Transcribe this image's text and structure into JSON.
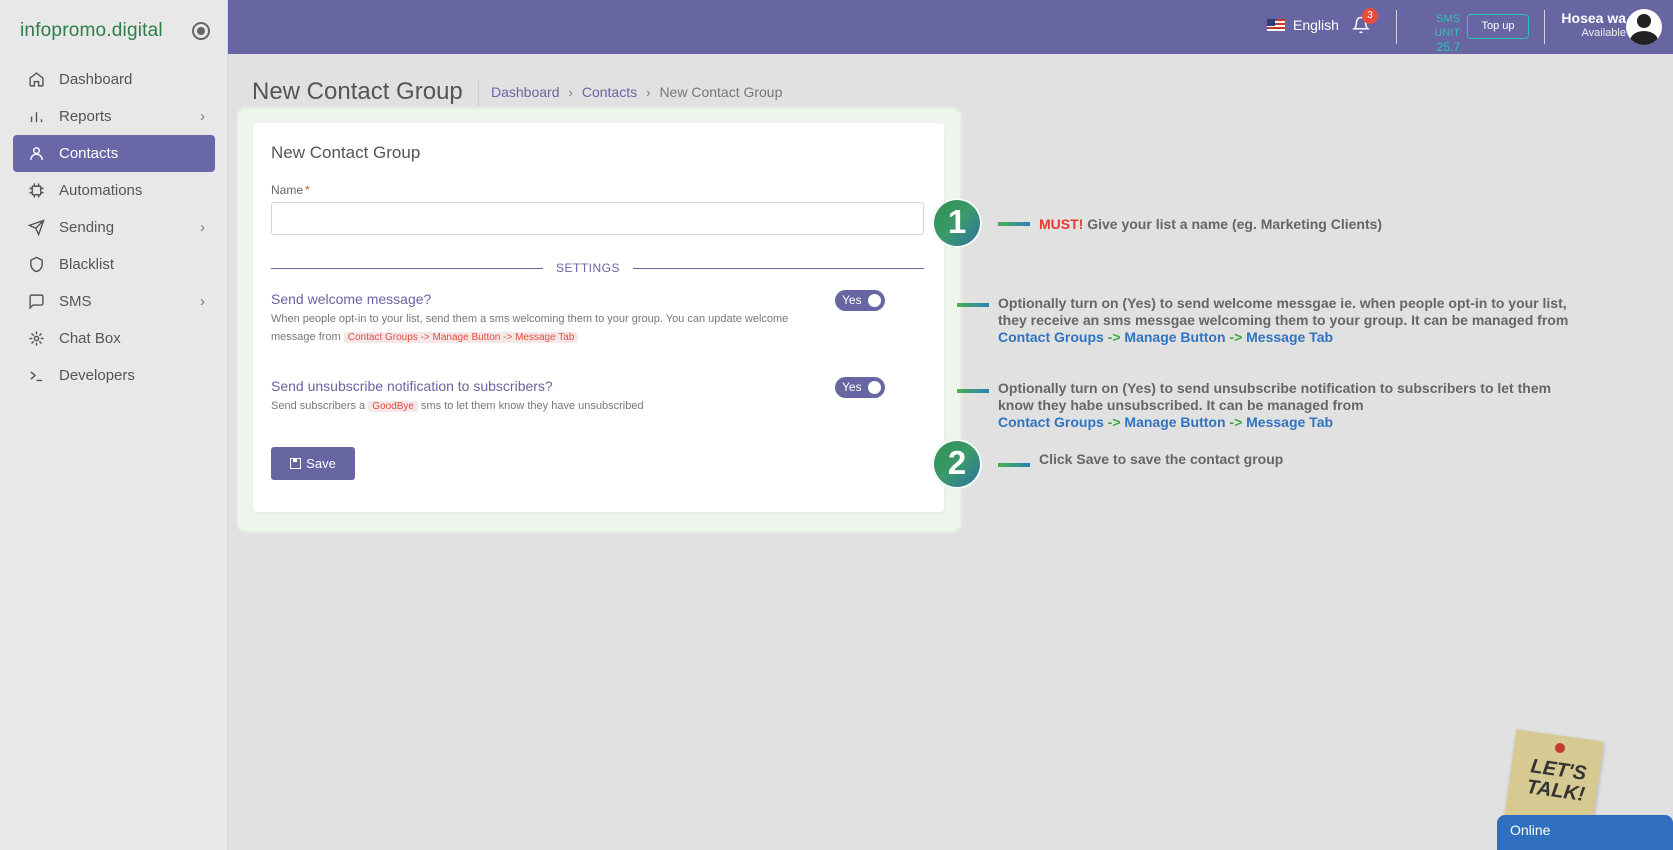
{
  "brand": "infopromo.digital",
  "sidebar": {
    "items": [
      {
        "label": "Dashboard",
        "icon": "home-icon"
      },
      {
        "label": "Reports",
        "icon": "bar-chart-icon",
        "chevron": "›"
      },
      {
        "label": "Contacts",
        "icon": "user-icon",
        "active": true
      },
      {
        "label": "Automations",
        "icon": "chip-icon"
      },
      {
        "label": "Sending",
        "icon": "send-icon",
        "chevron": "›"
      },
      {
        "label": "Blacklist",
        "icon": "shield-icon"
      },
      {
        "label": "SMS",
        "icon": "chat-icon",
        "chevron": "›"
      },
      {
        "label": "Chat Box",
        "icon": "chatbox-icon"
      },
      {
        "label": "Developers",
        "icon": "terminal-icon"
      }
    ]
  },
  "topbar": {
    "language": "English",
    "notifications_count": "3",
    "sms_unit_label": "SMS UNIT",
    "sms_unit_value": "25.7",
    "topup_label": "Top up",
    "user_name": "Hosea wa",
    "user_status": "Available"
  },
  "page": {
    "title": "New Contact Group",
    "breadcrumb": [
      "Dashboard",
      "Contacts",
      "New Contact Group"
    ]
  },
  "form": {
    "card_title": "New Contact Group",
    "name_label": "Name",
    "name_required": "*",
    "name_value": "",
    "settings_label": "SETTINGS",
    "welcome": {
      "title": "Send welcome message?",
      "desc_part1": "When people opt-in to your list, send them a sms welcoming them to your group. You can update welcome message from",
      "code": "Contact Groups -> Manage Button -> Message Tab",
      "toggle": "Yes"
    },
    "unsubscribe": {
      "title": "Send unsubscribe notification to subscribers?",
      "desc_part1": "Send subscribers a",
      "code": "GoodBye",
      "desc_part2": "sms to let them know they have unsubscribed",
      "toggle": "Yes"
    },
    "save_label": "Save"
  },
  "annotations": {
    "step1": "1",
    "step2": "2",
    "a1_must": "MUST!",
    "a1_text": "Give your list a name (eg. Marketing Clients)",
    "a2_text": "Optionally turn on (Yes) to send welcome messgae ie. when people opt-in to your list, they receive an sms messgae welcoming them to your group. It can be managed from",
    "a3_text": "Optionally turn on (Yes) to send unsubscribe notification to subscribers to let them know they habe unsubscribed. It can be managed from",
    "link_contact_groups": "Contact Groups",
    "link_manage_button": "Manage Button",
    "link_message_tab": "Message Tab",
    "arrow": "->",
    "a4_text": "Click Save to save the contact group"
  },
  "chat": {
    "lets_talk": "LET'S TALK!",
    "online": "Online"
  }
}
